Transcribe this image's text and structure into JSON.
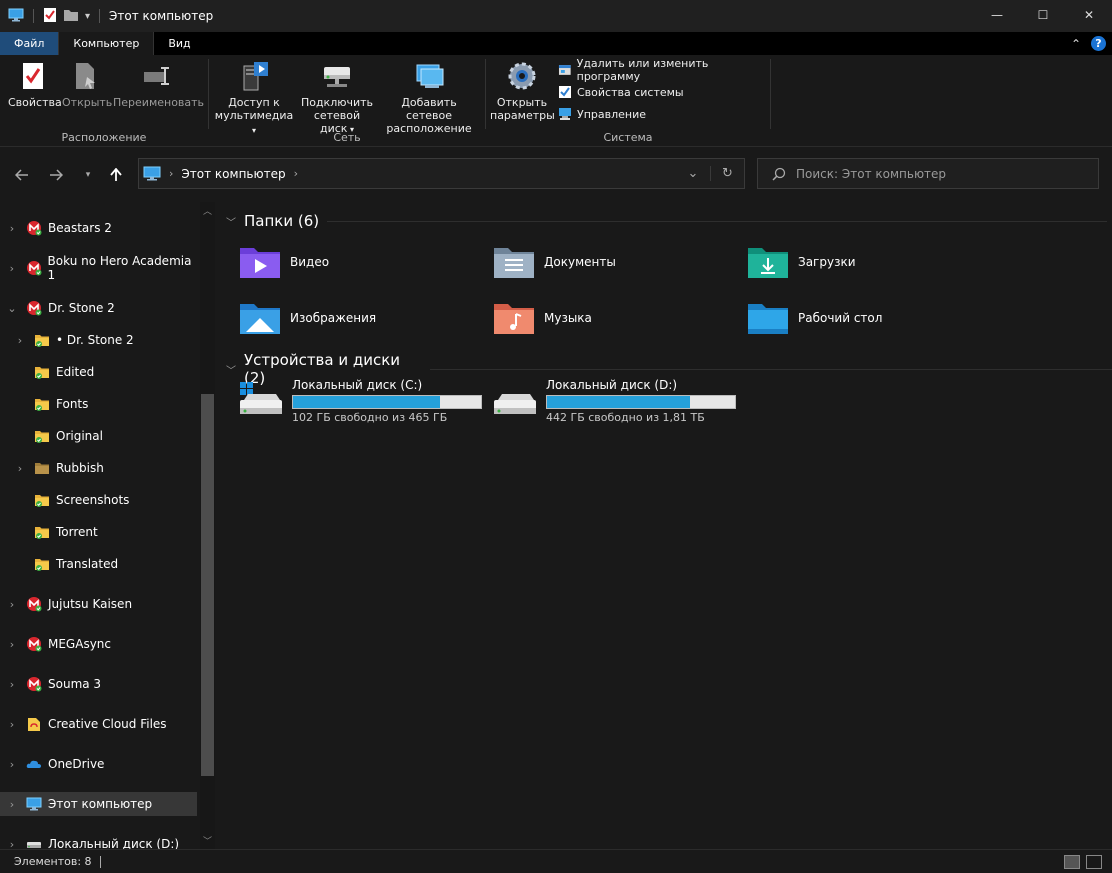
{
  "window": {
    "title": "Этот компьютер",
    "controls": {
      "minimize": "—",
      "maximize": "☐",
      "close": "✕"
    }
  },
  "ribbon_tabs": [
    {
      "label": "Файл"
    },
    {
      "label": "Компьютер"
    },
    {
      "label": "Вид"
    }
  ],
  "ribbon": {
    "location": {
      "name": "Расположение",
      "properties": "Свойства",
      "open": "Открыть",
      "rename": "Переименовать"
    },
    "network": {
      "name": "Сеть",
      "media_l1": "Доступ к",
      "media_l2": "мультимедиа",
      "map_l1": "Подключить",
      "map_l2": "сетевой диск",
      "add_l1": "Добавить сетевое",
      "add_l2": "расположение"
    },
    "system": {
      "name": "Система",
      "settings_l1": "Открыть",
      "settings_l2": "параметры",
      "uninstall": "Удалить или изменить программу",
      "sysprops": "Свойства системы",
      "manage": "Управление"
    }
  },
  "address": {
    "path": "Этот компьютер",
    "search_placeholder": "Поиск: Этот компьютер"
  },
  "nav_pane": {
    "items": [
      {
        "label": "Beastars 2",
        "icon": "mega-icon"
      },
      {
        "label": "Boku no Hero Academia 1",
        "icon": "mega-icon"
      },
      {
        "label": "Dr. Stone 2",
        "icon": "mega-icon"
      },
      {
        "label": "• Dr. Stone 2",
        "icon": "synced-folder-icon"
      },
      {
        "label": "Edited",
        "icon": "synced-folder-icon"
      },
      {
        "label": "Fonts",
        "icon": "synced-folder-icon"
      },
      {
        "label": "Original",
        "icon": "synced-folder-icon"
      },
      {
        "label": "Rubbish",
        "icon": "folder-icon"
      },
      {
        "label": "Screenshots",
        "icon": "synced-folder-icon"
      },
      {
        "label": "Torrent",
        "icon": "synced-folder-icon"
      },
      {
        "label": "Translated",
        "icon": "synced-folder-icon"
      },
      {
        "label": "Jujutsu Kaisen",
        "icon": "mega-icon"
      },
      {
        "label": "MEGAsync",
        "icon": "mega-icon"
      },
      {
        "label": "Souma 3",
        "icon": "mega-icon"
      },
      {
        "label": "Creative Cloud Files",
        "icon": "creative-cloud-icon"
      },
      {
        "label": "OneDrive",
        "icon": "onedrive-icon"
      },
      {
        "label": "Этот компьютер",
        "icon": "computer-icon"
      },
      {
        "label": "Локальный диск (D:)",
        "icon": "drive-icon"
      }
    ]
  },
  "content": {
    "folders_header": "Папки (6)",
    "folders": [
      {
        "label": "Видео",
        "icon": "videos-folder-icon"
      },
      {
        "label": "Документы",
        "icon": "documents-folder-icon"
      },
      {
        "label": "Загрузки",
        "icon": "downloads-folder-icon"
      },
      {
        "label": "Изображения",
        "icon": "pictures-folder-icon"
      },
      {
        "label": "Музыка",
        "icon": "music-folder-icon"
      },
      {
        "label": "Рабочий стол",
        "icon": "desktop-folder-icon"
      }
    ],
    "devices_header": "Устройства и диски (2)",
    "drives": [
      {
        "label": "Локальный диск (C:)",
        "free": "102 ГБ свободно из 465 ГБ",
        "used_fraction": 0.78
      },
      {
        "label": "Локальный диск (D:)",
        "free": "442 ГБ свободно из 1,81 ТБ",
        "used_fraction": 0.76
      }
    ]
  },
  "status": {
    "items_count": "Элементов: 8"
  },
  "colors": {
    "accent": "#26a0da",
    "file_tab": "#1f4c7a",
    "mega_red": "#d9272e",
    "sync_green": "#3cb043"
  }
}
